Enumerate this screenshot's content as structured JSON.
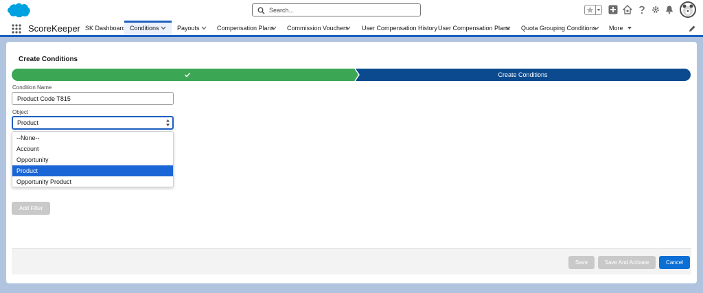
{
  "header": {
    "search_placeholder": "Search...",
    "icons": [
      "salesforce-cloud-logo",
      "search-icon",
      "favorites-star-icon",
      "add-icon",
      "trailhead-icon",
      "help-icon",
      "settings-gear-icon",
      "notifications-bell-icon",
      "user-avatar"
    ]
  },
  "nav": {
    "app_name": "ScoreKeeper",
    "items": [
      {
        "label": "SK Dashboard",
        "has_menu": false
      },
      {
        "label": "Conditions",
        "has_menu": true,
        "active": true
      },
      {
        "label": "Payouts",
        "has_menu": true
      },
      {
        "label": "Compensation Plans",
        "has_menu": true
      },
      {
        "label": "Commission Vouchers",
        "has_menu": true
      },
      {
        "label": "User Compensation History",
        "has_menu": false
      },
      {
        "label": "User Compensation Plans",
        "has_menu": true
      },
      {
        "label": "Quota Grouping Conditions",
        "has_menu": true
      },
      {
        "label": "More",
        "has_menu": true
      }
    ]
  },
  "page": {
    "title": "Create Conditions",
    "path": {
      "completed_step": "",
      "current_step": "Create Conditions"
    },
    "condition_name": {
      "label": "Condition Name",
      "value": "Product Code T815"
    },
    "object": {
      "label": "Object",
      "value": "Product",
      "options": [
        "--None--",
        "Account",
        "Opportunity",
        "Product",
        "Opportunity Product"
      ],
      "selected_index": 3
    },
    "add_filter_label": "Add Filter",
    "footer": {
      "save_label": "Save",
      "save_activate_label": "Save And Activate",
      "cancel_label": "Cancel"
    }
  },
  "colors": {
    "brand_blue": "#0b6fd6",
    "path_complete": "#3ba755",
    "path_current": "#0b4a8f",
    "background": "#b0c4df"
  }
}
